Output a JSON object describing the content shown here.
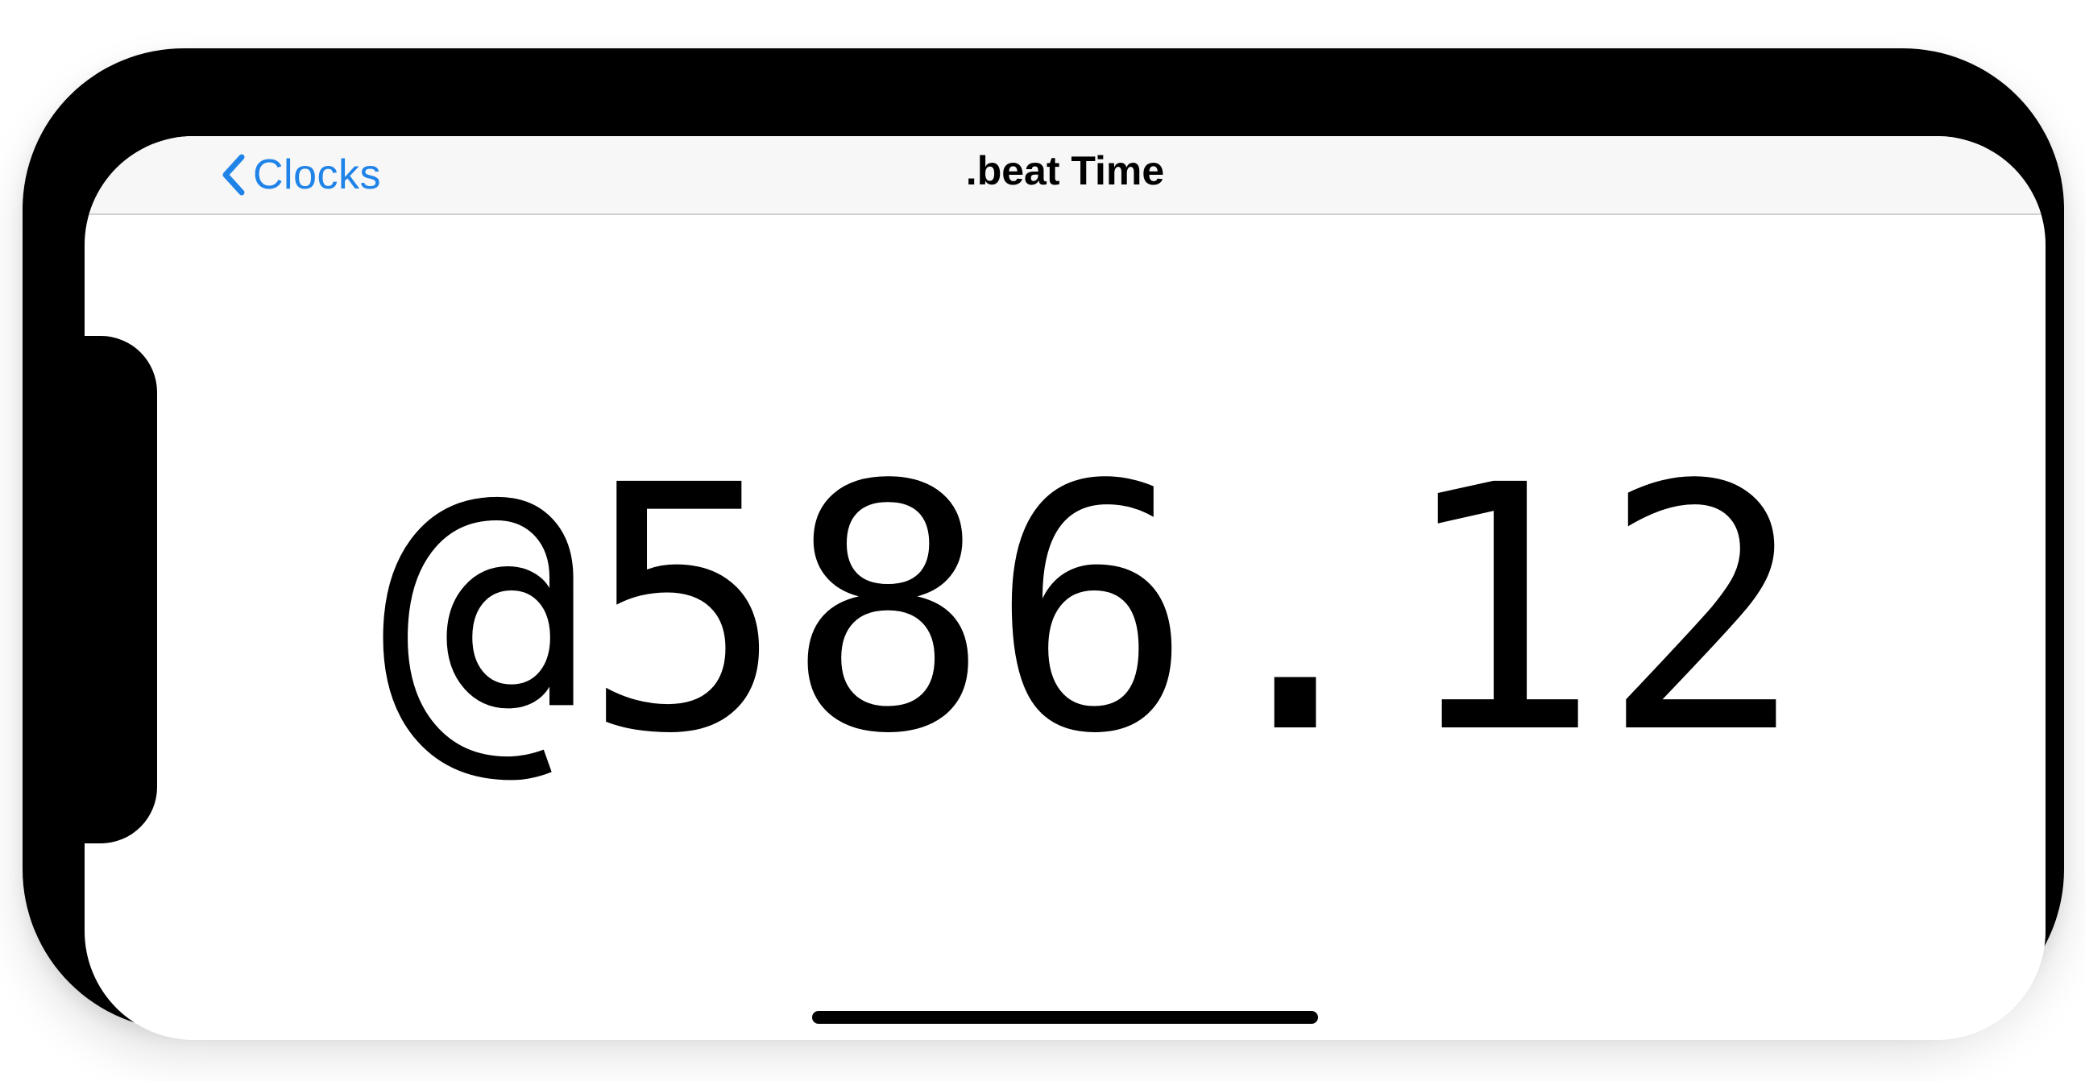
{
  "navbar": {
    "back_label": "Clocks",
    "title": ".beat Time"
  },
  "main": {
    "beat_time": "@586.12"
  },
  "colors": {
    "accent": "#1f83e8",
    "navbar_background": "#f7f7f7",
    "device_frame": "#000000"
  },
  "icons": {
    "back": "chevron-left-icon"
  }
}
